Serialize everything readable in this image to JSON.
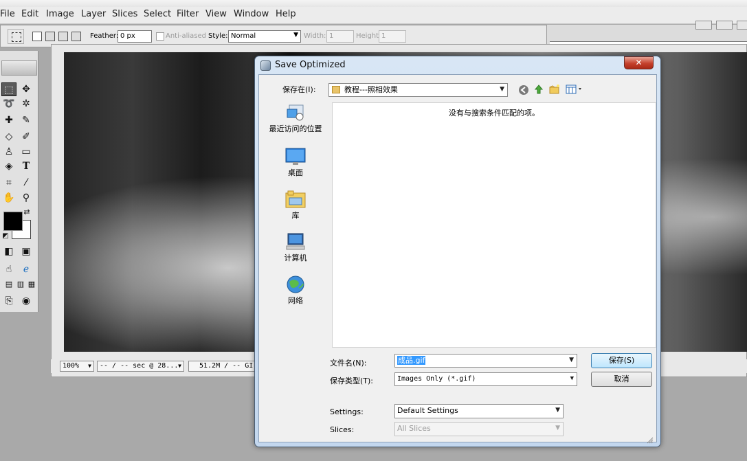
{
  "app": {
    "menu": [
      "File",
      "Edit",
      "Image",
      "Layer",
      "Slices",
      "Select",
      "Filter",
      "View",
      "Window",
      "Help"
    ]
  },
  "options_bar": {
    "feather_label": "Feather:",
    "feather_value": "0 px",
    "anti_aliased_label": "Anti-aliased",
    "style_label": "Style:",
    "style_value": "Normal",
    "width_label": "Width:",
    "width_value": "1",
    "height_label": "Height:",
    "height_value": "1"
  },
  "document": {
    "zoom": "100%",
    "download_time": "-- / -- sec @ 28...",
    "file_size": "51.2M / -- GI"
  },
  "toolbox": {
    "type_tool_glyph": "T",
    "foreground_color": "#000000",
    "background_color": "#ffffff"
  },
  "dialog": {
    "title": "Save Optimized",
    "close_glyph": "✕",
    "save_in_label": "保存在(I):",
    "save_in_value": "教程---照相效果",
    "empty_message": "没有与搜索条件匹配的项。",
    "places": [
      {
        "label": "最近访问的位置",
        "icon": "recent-places-icon"
      },
      {
        "label": "桌面",
        "icon": "desktop-icon"
      },
      {
        "label": "库",
        "icon": "libraries-icon"
      },
      {
        "label": "计算机",
        "icon": "computer-icon"
      },
      {
        "label": "网络",
        "icon": "network-icon"
      }
    ],
    "filename_label": "文件名(N):",
    "filename_value": "成品.gif",
    "filetype_label": "保存类型(T):",
    "filetype_value": "Images Only (*.gif)",
    "save_button": "保存(S)",
    "cancel_button": "取消",
    "settings_label": "Settings:",
    "settings_value": "Default Settings",
    "slices_label": "Slices:",
    "slices_value": "All Slices"
  },
  "colors": {
    "dialog_frame": "#c3d7ee",
    "close_button": "#c5412c",
    "selection_highlight": "#3399ff",
    "default_button": "#bee6fd"
  }
}
